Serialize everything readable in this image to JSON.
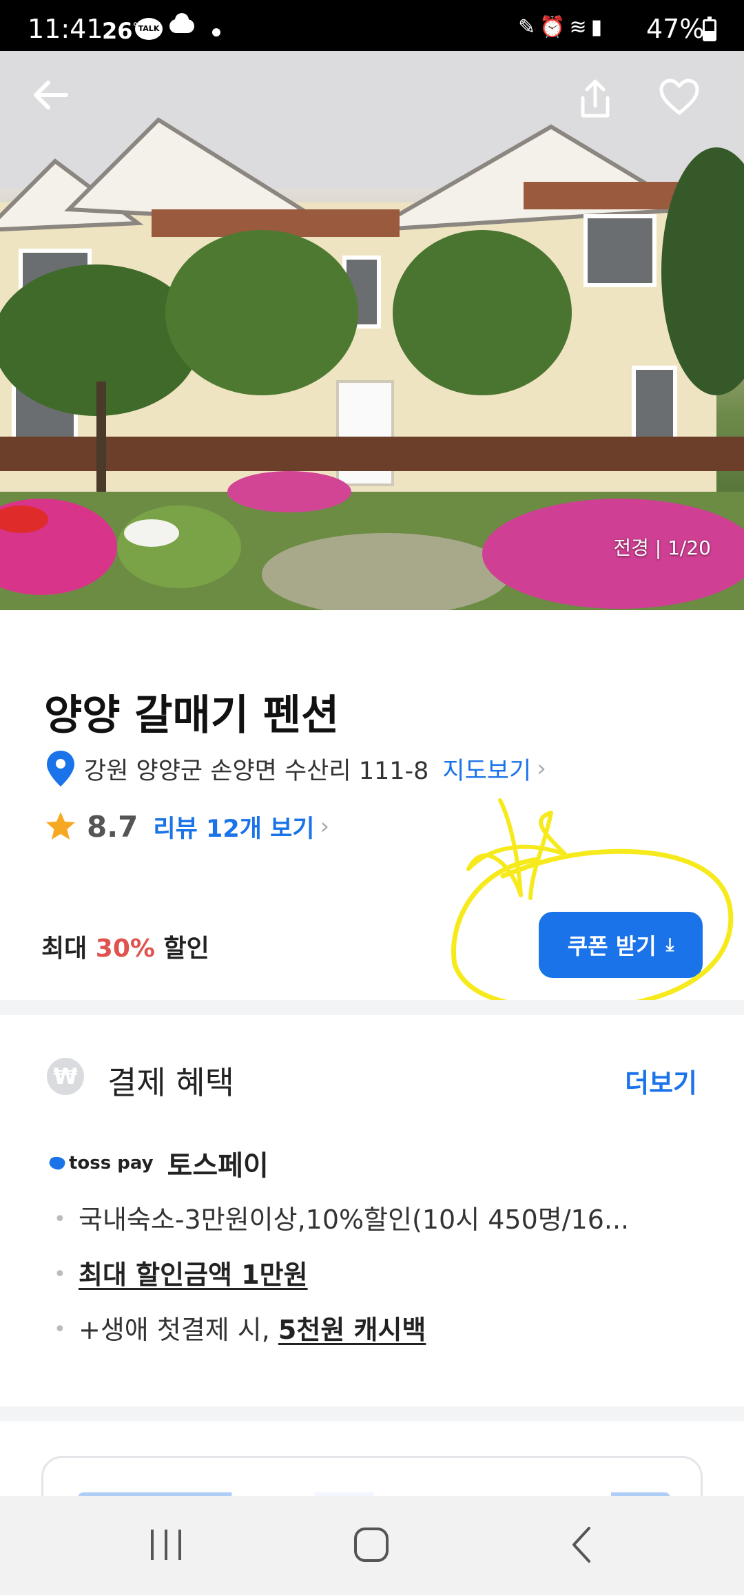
{
  "status_bar": {
    "time": "11:41",
    "temperature": "26",
    "temperature_unit": "°",
    "talk_badge": "TALK",
    "battery": "47%"
  },
  "hero": {
    "photo_counter": "전경 | 1/20"
  },
  "listing": {
    "name": "양양 갈매기 펜션",
    "address": "강원 양양군 손양면 수산리 111-8",
    "map_link": "지도보기",
    "rating": "8.7",
    "review_link": "리뷰 12개 보기"
  },
  "discount": {
    "prefix": "최대 ",
    "percent": "30%",
    "suffix": " 할인",
    "coupon_button": "쿠폰 받기",
    "coupon_icon": "download-icon"
  },
  "payment_benefits": {
    "title": "결제 혜택",
    "more": "더보기",
    "currency_icon": "₩",
    "provider_logo": "toss pay",
    "provider_name": "토스페이",
    "items": [
      {
        "text": "국내숙소-3만원이상,10%할인(10시 450명/16..."
      },
      {
        "text": "최대 할인금액 1만원"
      },
      {
        "prefix": "+생애 첫결제 시, ",
        "highlight": "5천원 캐시백"
      }
    ]
  },
  "colors": {
    "accent": "#1a73e8",
    "discount": "#e0524e",
    "annotation": "#f7ea1c"
  }
}
